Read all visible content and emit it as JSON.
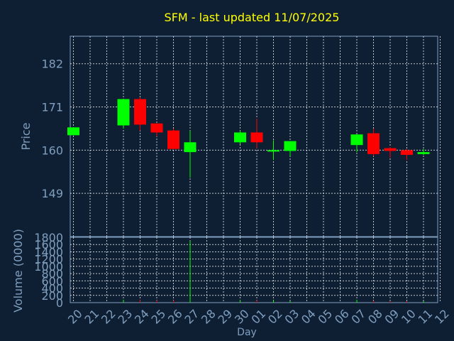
{
  "chart_data": {
    "type": "candlestick",
    "title": "SFM - last updated 11/07/2025",
    "xlabel": "Day",
    "ylabel": "Price",
    "volume_label": "Volume (0000)",
    "price_ticks": [
      149,
      160,
      171,
      182
    ],
    "price_range": [
      138,
      189
    ],
    "volume_ticks": [
      0,
      200,
      400,
      600,
      800,
      1000,
      1200,
      1400,
      1600,
      1800
    ],
    "volume_range": [
      0,
      1800
    ],
    "x_ticks": [
      "20",
      "21",
      "22",
      "23",
      "24",
      "25",
      "26",
      "27",
      "28",
      "29",
      "30",
      "01",
      "02",
      "03",
      "04",
      "05",
      "06",
      "07",
      "08",
      "09",
      "10",
      "11",
      "12"
    ],
    "grid": true,
    "colors": {
      "up": "#00ff00",
      "down": "#ff0000",
      "text": "#7f9fbf",
      "title": "#ffff00",
      "background": "#0f1f33",
      "plot": "#0f1f33",
      "grid": "#ffffff"
    },
    "candles": [
      {
        "day": "20",
        "open": 163.8,
        "high": 165.8,
        "low": 163.8,
        "close": 165.8,
        "volume": 0
      },
      {
        "day": "23",
        "open": 166.3,
        "high": 173.0,
        "low": 165.5,
        "close": 173.0,
        "volume": 80
      },
      {
        "day": "24",
        "open": 173.0,
        "high": 173.5,
        "low": 165.0,
        "close": 166.5,
        "volume": 70
      },
      {
        "day": "25",
        "open": 166.8,
        "high": 166.8,
        "low": 163.5,
        "close": 164.5,
        "volume": 60
      },
      {
        "day": "26",
        "open": 165.0,
        "high": 165.5,
        "low": 160.3,
        "close": 160.3,
        "volume": 60
      },
      {
        "day": "27",
        "open": 159.5,
        "high": 165.0,
        "low": 153.0,
        "close": 162.0,
        "volume": 1700
      },
      {
        "day": "30",
        "open": 162.0,
        "high": 165.0,
        "low": 161.5,
        "close": 164.5,
        "volume": 70
      },
      {
        "day": "01",
        "open": 164.5,
        "high": 168.0,
        "low": 160.5,
        "close": 162.0,
        "volume": 60
      },
      {
        "day": "02",
        "open": 160.0,
        "high": 162.5,
        "low": 157.5,
        "close": 160.0,
        "volume": 60
      },
      {
        "day": "03",
        "open": 159.8,
        "high": 162.3,
        "low": 158.5,
        "close": 162.3,
        "volume": 40
      },
      {
        "day": "07",
        "open": 161.3,
        "high": 164.0,
        "low": 159.5,
        "close": 164.0,
        "volume": 80
      },
      {
        "day": "08",
        "open": 164.3,
        "high": 165.5,
        "low": 158.5,
        "close": 159.0,
        "volume": 50
      },
      {
        "day": "09",
        "open": 160.5,
        "high": 160.8,
        "low": 158.0,
        "close": 159.8,
        "volume": 40
      },
      {
        "day": "10",
        "open": 160.0,
        "high": 160.3,
        "low": 157.5,
        "close": 158.8,
        "volume": 40
      },
      {
        "day": "11",
        "open": 159.0,
        "high": 160.3,
        "low": 158.8,
        "close": 159.5,
        "volume": 40
      }
    ]
  }
}
